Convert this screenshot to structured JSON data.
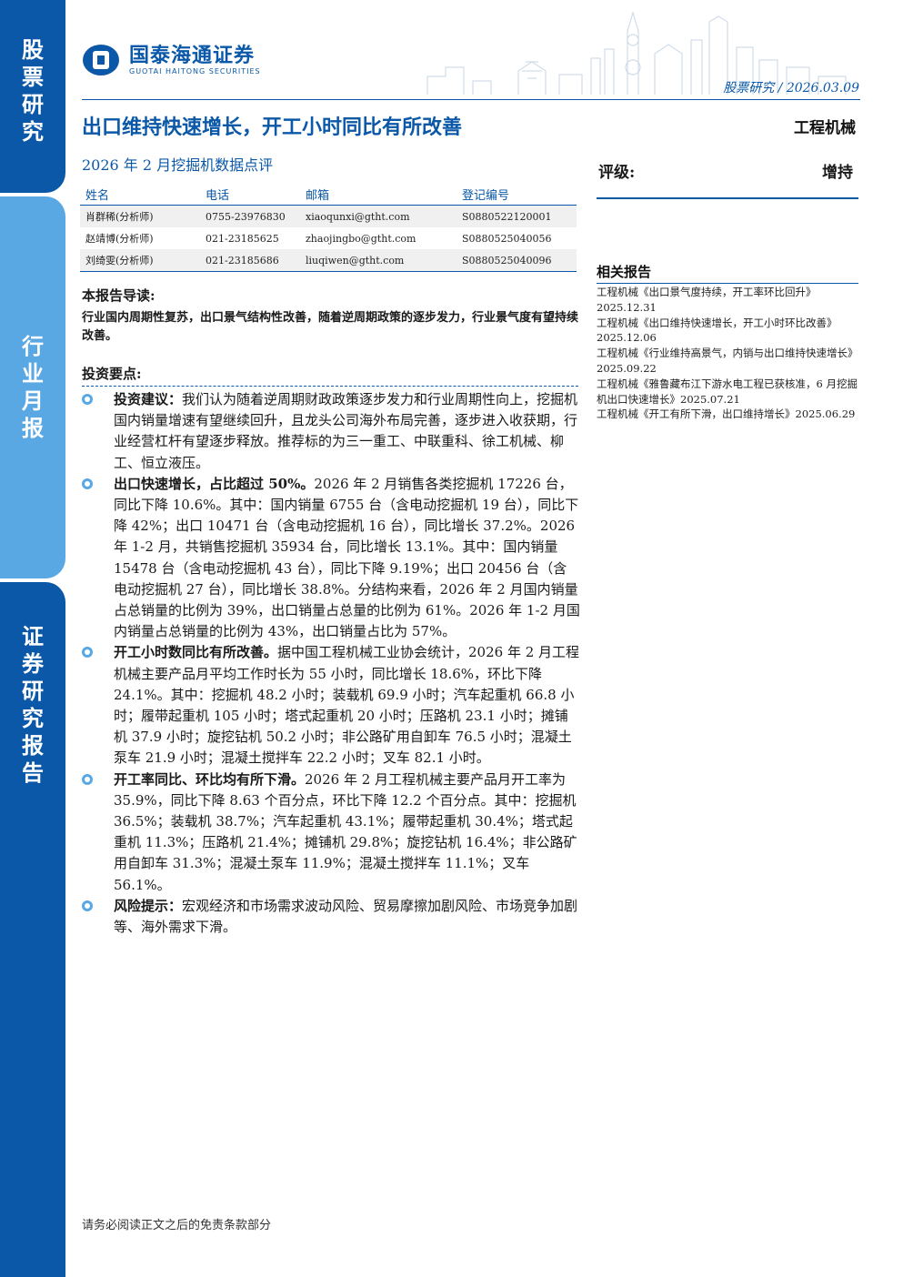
{
  "sidebar": {
    "block1": [
      "股",
      "票",
      "研",
      "究"
    ],
    "block2": [
      "行",
      "业",
      "月",
      "报"
    ],
    "block3": [
      "证",
      "券",
      "研",
      "究",
      "报",
      "告"
    ]
  },
  "logo": {
    "cn": "国泰海通证券",
    "en": "GUOTAI HAITONG SECURITIES"
  },
  "header": {
    "category": "股票研究",
    "separator": "/",
    "date": "2026.03.09"
  },
  "report": {
    "title": "出口维持快速增长，开工小时同比有所改善",
    "industry": "工程机械",
    "subtitle": "2026 年 2 月挖掘机数据点评"
  },
  "analysts": {
    "headers": [
      "姓名",
      "电话",
      "邮箱",
      "登记编号"
    ],
    "rows": [
      [
        "肖群稀(分析师)",
        "0755-23976830",
        "xiaoqunxi@gtht.com",
        "S0880522120001"
      ],
      [
        "赵靖博(分析师)",
        "021-23185625",
        "zhaojingbo@gtht.com",
        "S0880525040056"
      ],
      [
        "刘绮雯(分析师)",
        "021-23185686",
        "liuqiwen@gtht.com",
        "S0880525040096"
      ]
    ]
  },
  "rating": {
    "label": "评级:",
    "value": "增持"
  },
  "related": {
    "title": "相关报告",
    "items": [
      "工程机械《出口景气度持续，开工率环比回升》2025.12.31",
      "工程机械《出口维持快速增长，开工小时环比改善》2025.12.06",
      "工程机械《行业维持高景气，内销与出口维持快速增长》2025.09.22",
      "工程机械《雅鲁藏布江下游水电工程已获核准，6 月挖掘机出口快速增长》2025.07.21",
      "工程机械《开工有所下滑，出口维持增长》2025.06.29"
    ]
  },
  "guide": {
    "title": "本报告导读:",
    "text": "行业国内周期性复苏，出口景气结构性改善，随着逆周期政策的逐步发力，行业景气度有望持续改善。"
  },
  "points": {
    "title": "投资要点:",
    "items": [
      {
        "head": "投资建议：",
        "body": "我们认为随着逆周期财政政策逐步发力和行业周期性向上，挖掘机国内销量增速有望继续回升，且龙头公司海外布局完善，逐步进入收获期，行业经营杠杆有望逐步释放。推荐标的为三一重工、中联重科、徐工机械、柳工、恒立液压。"
      },
      {
        "head": "出口快速增长，占比超过 50%。",
        "body": "2026 年 2 月销售各类挖掘机 17226 台，同比下降 10.6%。其中：国内销量 6755 台（含电动挖掘机 19 台），同比下降 42%；出口 10471 台（含电动挖掘机 16 台），同比增长 37.2%。2026 年 1-2 月，共销售挖掘机 35934 台，同比增长 13.1%。其中：国内销量 15478 台（含电动挖掘机 43 台），同比下降 9.19%；出口 20456 台（含电动挖掘机 27 台），同比增长 38.8%。分结构来看，2026 年 2 月国内销量占总销量的比例为 39%，出口销量占总量的比例为 61%。2026 年 1-2 月国内销量占总销量的比例为 43%，出口销量占比为 57%。"
      },
      {
        "head": "开工小时数同比有所改善。",
        "body": "据中国工程机械工业协会统计，2026 年 2 月工程机械主要产品月平均工作时长为 55 小时，同比增长 18.6%，环比下降 24.1%。其中：挖掘机 48.2 小时；装载机 69.9 小时；汽车起重机 66.8 小时；履带起重机 105 小时；塔式起重机 20 小时；压路机 23.1 小时；摊铺机 37.9 小时；旋挖钻机 50.2 小时；非公路矿用自卸车 76.5 小时；混凝土泵车 21.9 小时；混凝土搅拌车 22.2 小时；叉车 82.1 小时。"
      },
      {
        "head": "开工率同比、环比均有所下滑。",
        "body": "2026 年 2 月工程机械主要产品月开工率为 35.9%，同比下降 8.63 个百分点，环比下降 12.2 个百分点。其中：挖掘机 36.5%；装载机 38.7%；汽车起重机 43.1%；履带起重机 30.4%；塔式起重机 11.3%；压路机 21.4%；摊铺机 29.8%；旋挖钻机 16.4%；非公路矿用自卸车 31.3%；混凝土泵车 11.9%；混凝土搅拌车 11.1%；叉车 56.1%。"
      },
      {
        "head": "风险提示：",
        "body": "宏观经济和市场需求波动风险、贸易摩擦加剧风险、市场竞争加剧等、海外需求下滑。"
      }
    ]
  },
  "footer": {
    "note": "请务必阅读正文之后的免责条款部分"
  },
  "colors": {
    "brand": "#0a58a7",
    "accent": "#5aa8e3"
  }
}
